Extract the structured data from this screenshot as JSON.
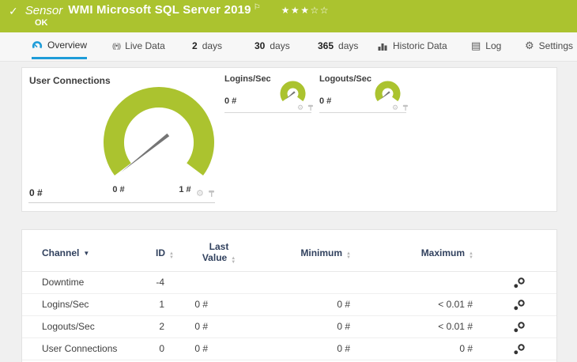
{
  "header": {
    "check": "✓",
    "kind": "Sensor",
    "title": "WMI Microsoft SQL Server 2019",
    "flag": "⚐",
    "stars": "★★★☆☆",
    "status": "OK"
  },
  "tabs": [
    {
      "label": "Overview"
    },
    {
      "label": "Live Data"
    },
    {
      "num": "2",
      "unit": "days"
    },
    {
      "num": "30",
      "unit": "days"
    },
    {
      "num": "365",
      "unit": "days"
    },
    {
      "label": "Historic Data"
    },
    {
      "label": "Log"
    },
    {
      "label": "Settings"
    }
  ],
  "gauges": {
    "main": {
      "title": "User Connections",
      "value": "0 #",
      "scale_min": "0 #",
      "scale_max": "1 #"
    },
    "logins": {
      "title": "Logins/Sec",
      "value": "0 #"
    },
    "logouts": {
      "title": "Logouts/Sec",
      "value": "0 #"
    }
  },
  "table": {
    "headers": {
      "channel": "Channel",
      "id": "ID",
      "last_line1": "Last",
      "last_line2": "Value",
      "minimum": "Minimum",
      "maximum": "Maximum"
    },
    "rows": [
      {
        "channel": "Downtime",
        "id": "-4",
        "last": "",
        "min": "",
        "max": ""
      },
      {
        "channel": "Logins/Sec",
        "id": "1",
        "last": "0 #",
        "min": "0 #",
        "max": "< 0.01 #"
      },
      {
        "channel": "Logouts/Sec",
        "id": "2",
        "last": "0 #",
        "min": "0 #",
        "max": "< 0.01 #"
      },
      {
        "channel": "User Connections",
        "id": "0",
        "last": "0 #",
        "min": "0 #",
        "max": "0 #"
      }
    ]
  },
  "icons": {
    "gear": "⚙",
    "log": "▤",
    "live": "((•))",
    "sort_up": "▲",
    "sort_down": "▼",
    "caret": "▼"
  },
  "colors": {
    "status_green": "#abc32f",
    "accent_blue": "#1e9cd8",
    "needle_gray": "#757575"
  }
}
